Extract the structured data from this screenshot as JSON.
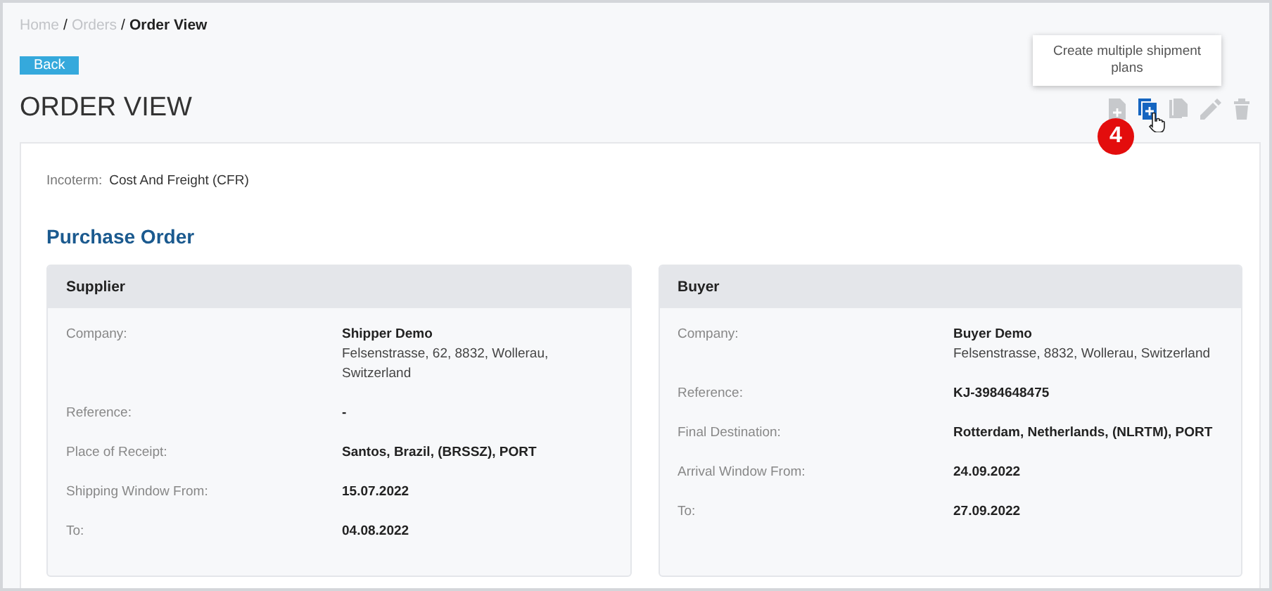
{
  "breadcrumb": [
    {
      "label": "Home",
      "current": false
    },
    {
      "label": "Orders",
      "current": false
    },
    {
      "label": "Order View",
      "current": true
    }
  ],
  "breadcrumb_separator": "/",
  "back_button": "Back",
  "title": "ORDER VIEW",
  "toolbar": [
    {
      "kind": "add-file",
      "selected": false
    },
    {
      "kind": "copy-plus",
      "selected": true
    },
    {
      "kind": "copy",
      "selected": false
    },
    {
      "kind": "edit",
      "selected": false
    },
    {
      "kind": "delete",
      "selected": false
    }
  ],
  "tooltip": "Create multiple shipment plans",
  "step_badge": "4",
  "incoterm": {
    "label": "Incoterm:",
    "value": "Cost And Freight (CFR)"
  },
  "section_title": "Purchase Order",
  "cards": [
    {
      "title": "Supplier",
      "fields": [
        {
          "label": "Company:",
          "value": "Shipper Demo",
          "address": "Felsenstrasse, 62, 8832, Wollerau, Switzerland"
        },
        {
          "label": "Reference:",
          "value": "-"
        },
        {
          "label": "Place of Receipt:",
          "value": "Santos, Brazil, (BRSSZ), PORT"
        },
        {
          "label": "Shipping Window From:",
          "value": "15.07.2022"
        },
        {
          "label": "To:",
          "value": "04.08.2022"
        }
      ]
    },
    {
      "title": "Buyer",
      "fields": [
        {
          "label": "Company:",
          "value": "Buyer Demo",
          "address": "Felsenstrasse, 8832, Wollerau, Switzerland"
        },
        {
          "label": "Reference:",
          "value": "KJ-3984648475"
        },
        {
          "label": "Final Destination:",
          "value": "Rotterdam, Netherlands, (NLRTM), PORT"
        },
        {
          "label": "Arrival Window From:",
          "value": "24.09.2022"
        },
        {
          "label": "To:",
          "value": "27.09.2022"
        }
      ]
    }
  ]
}
